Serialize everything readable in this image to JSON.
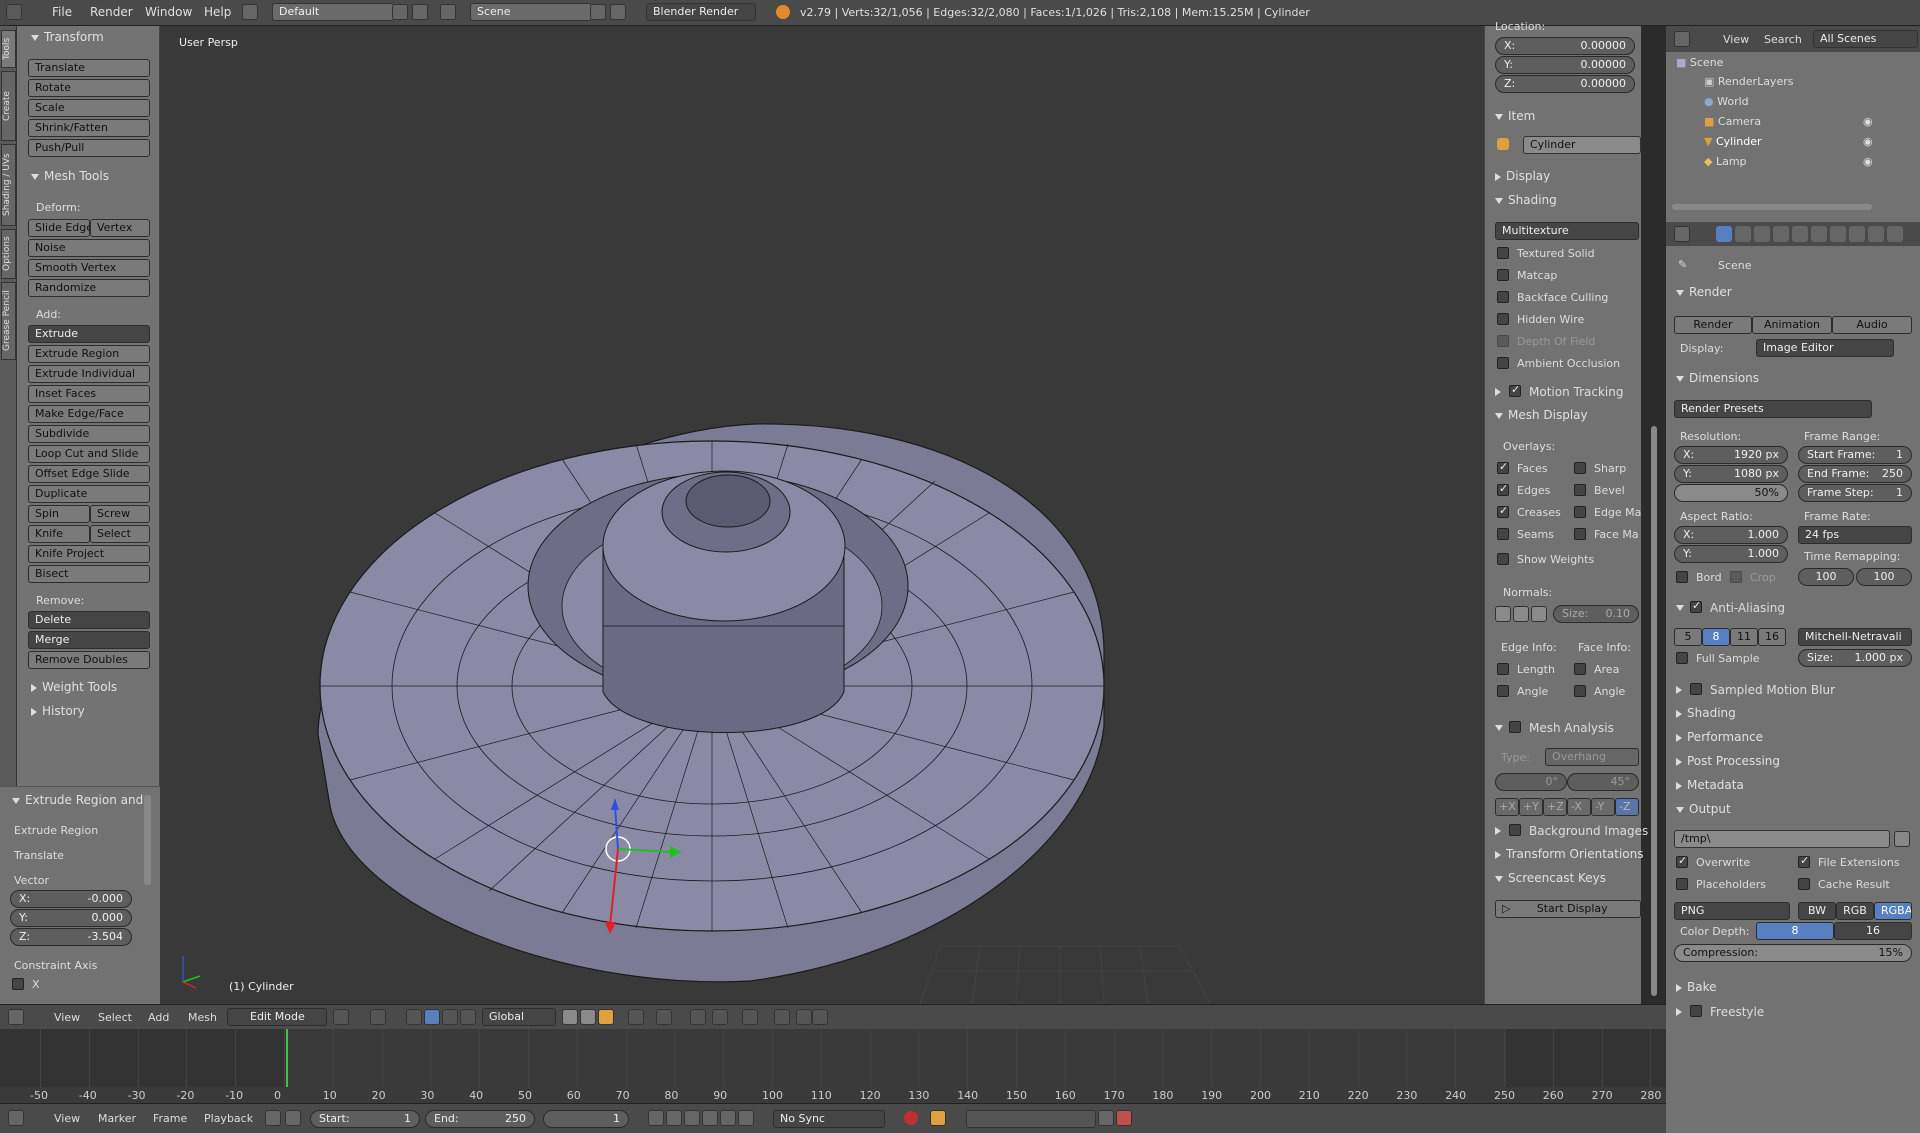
{
  "topbar": {
    "menus": [
      "File",
      "Render",
      "Window",
      "Help"
    ],
    "layout": "Default",
    "scene": "Scene",
    "engine": "Blender Render",
    "stats": "v2.79 | Verts:32/1,056 | Edges:32/2,080 | Faces:1/1,026 | Tris:2,108 | Mem:15.25M | Cylinder"
  },
  "tabs": [
    "Tools",
    "Create",
    "Shading / UVs",
    "Options",
    "Grease Pencil"
  ],
  "tools": {
    "transform_header": "Transform",
    "transform": [
      "Translate",
      "Rotate",
      "Scale",
      "Shrink/Fatten",
      "Push/Pull"
    ],
    "mesh_header": "Mesh Tools",
    "deform_label": "Deform:",
    "slide_edge": "Slide Edge",
    "vertex": "Vertex",
    "noise": "Noise",
    "smooth_vertex": "Smooth Vertex",
    "randomize": "Randomize",
    "add_label": "Add:",
    "extrude": "Extrude",
    "add": [
      "Extrude Region",
      "Extrude Individual",
      "Inset Faces",
      "Make Edge/Face",
      "Subdivide",
      "Loop Cut and Slide",
      "Offset Edge Slide",
      "Duplicate"
    ],
    "spin": "Spin",
    "screw": "Screw",
    "knife": "Knife",
    "select": "Select",
    "knife_project": "Knife Project",
    "bisect": "Bisect",
    "remove_label": "Remove:",
    "delete": "Delete",
    "merge": "Merge",
    "remove_doubles": "Remove Doubles",
    "weight_tools": "Weight Tools",
    "history": "History"
  },
  "redo": {
    "header": "Extrude Region and",
    "op1": "Extrude Region",
    "op2": "Translate",
    "vector": "Vector",
    "x_label": "X:",
    "x": "-0.000",
    "y_label": "Y:",
    "y": "0.000",
    "z_label": "Z:",
    "z": "-3.504",
    "constraint": "Constraint Axis",
    "cx": "X"
  },
  "viewport": {
    "view_label": "User Persp",
    "object_label": "(1) Cylinder",
    "colors": {
      "mesh": "#8a8aa6",
      "bg": "#393939"
    }
  },
  "npanel": {
    "location": "Location:",
    "lx_k": "X:",
    "lx": "0.00000",
    "ly_k": "Y:",
    "ly": "0.00000",
    "lz_k": "Z:",
    "lz": "0.00000",
    "item": "Item",
    "item_name": "Cylinder",
    "display": "Display",
    "shading": "Shading",
    "multitexture": "Multitexture",
    "shading_opts": [
      "Textured Solid",
      "Matcap",
      "Backface Culling",
      "Hidden Wire",
      "Depth Of Field",
      "Ambient Occlusion"
    ],
    "motion_tracking": "Motion Tracking",
    "mesh_display": "Mesh Display",
    "overlays": "Overlays:",
    "ov_left": [
      "Faces",
      "Edges",
      "Creases",
      "Seams"
    ],
    "ov_right": [
      "Sharp",
      "Bevel",
      "Edge Ma",
      "Face Ma"
    ],
    "show_weights": "Show Weights",
    "normals": "Normals:",
    "size": "Size:",
    "size_val": "0.10",
    "edge_info": "Edge Info:",
    "face_info": "Face Info:",
    "length": "Length",
    "area": "Area",
    "angle": "Angle",
    "angle2": "Angle",
    "mesh_analysis": "Mesh Analysis",
    "type": "Type:",
    "overhang": "Overhang",
    "deg0": "0°",
    "deg45": "45°",
    "axes": [
      "+X",
      "+Y",
      "+Z",
      "-X",
      "-Y",
      "-Z"
    ],
    "background_images": "Background Images",
    "transform_orientations": "Transform Orientations",
    "screencast_keys": "Screencast Keys",
    "start_display": "Start Display"
  },
  "outliner": {
    "view": "View",
    "search": "Search",
    "all_scenes": "All Scenes",
    "items": [
      "Scene",
      "RenderLayers",
      "World",
      "Camera",
      "Cylinder",
      "Lamp"
    ]
  },
  "props": {
    "scene": "Scene",
    "render": "Render",
    "render_btn": "Render",
    "animation": "Animation",
    "audio": "Audio",
    "display_label": "Display:",
    "display_val": "Image Editor",
    "dimensions": "Dimensions",
    "render_presets": "Render Presets",
    "resolution": "Resolution:",
    "rx_k": "X:",
    "rx": "1920 px",
    "ry_k": "Y:",
    "ry": "1080 px",
    "pct": "50%",
    "frame_range": "Frame Range:",
    "start_k": "Start Frame:",
    "start": "1",
    "end_k": "End Frame:",
    "end": "250",
    "step_k": "Frame Step:",
    "step": "1",
    "aspect": "Aspect Ratio:",
    "ax_k": "X:",
    "ax": "1.000",
    "ay_k": "Y:",
    "ay": "1.000",
    "frame_rate": "Frame Rate:",
    "fps": "24 fps",
    "bord": "Bord",
    "crop": "Crop",
    "time_remap": "Time Remapping:",
    "tr1": "100",
    "tr2": "100",
    "anti_aliasing": "Anti-Aliasing",
    "aa": [
      "5",
      "8",
      "11",
      "16"
    ],
    "filter": "Mitchell-Netravali",
    "full_sample": "Full Sample",
    "aa_size_k": "Size:",
    "aa_size": "1.000 px",
    "sampled_motion_blur": "Sampled Motion Blur",
    "shading": "Shading",
    "performance": "Performance",
    "post_processing": "Post Processing",
    "metadata": "Metadata",
    "output": "Output",
    "path": "/tmp\\",
    "overwrite": "Overwrite",
    "file_extensions": "File Extensions",
    "placeholders": "Placeholders",
    "cache_result": "Cache Result",
    "format": "PNG",
    "bw": "BW",
    "rgb": "RGB",
    "rgba": "RGBA",
    "color_depth": "Color Depth:",
    "cd8": "8",
    "cd16": "16",
    "compression": "Compression:",
    "comp_val": "15%",
    "bake": "Bake",
    "freestyle": "Freestyle"
  },
  "vhead": {
    "view": "View",
    "select": "Select",
    "add": "Add",
    "mesh": "Mesh",
    "mode": "Edit Mode",
    "orientation": "Global"
  },
  "timeline": {
    "ticks": [
      "-50",
      "-40",
      "-30",
      "-20",
      "-10",
      "0",
      "10",
      "20",
      "30",
      "40",
      "50",
      "60",
      "70",
      "80",
      "90",
      "100",
      "110",
      "120",
      "130",
      "140",
      "150",
      "160",
      "170",
      "180",
      "190",
      "200",
      "210",
      "220",
      "230",
      "240",
      "250",
      "260",
      "270",
      "280"
    ]
  },
  "thead": {
    "view": "View",
    "marker": "Marker",
    "frame": "Frame",
    "playback": "Playback",
    "start_k": "Start:",
    "start": "1",
    "end_k": "End:",
    "end": "250",
    "current": "1",
    "sync": "No Sync"
  }
}
